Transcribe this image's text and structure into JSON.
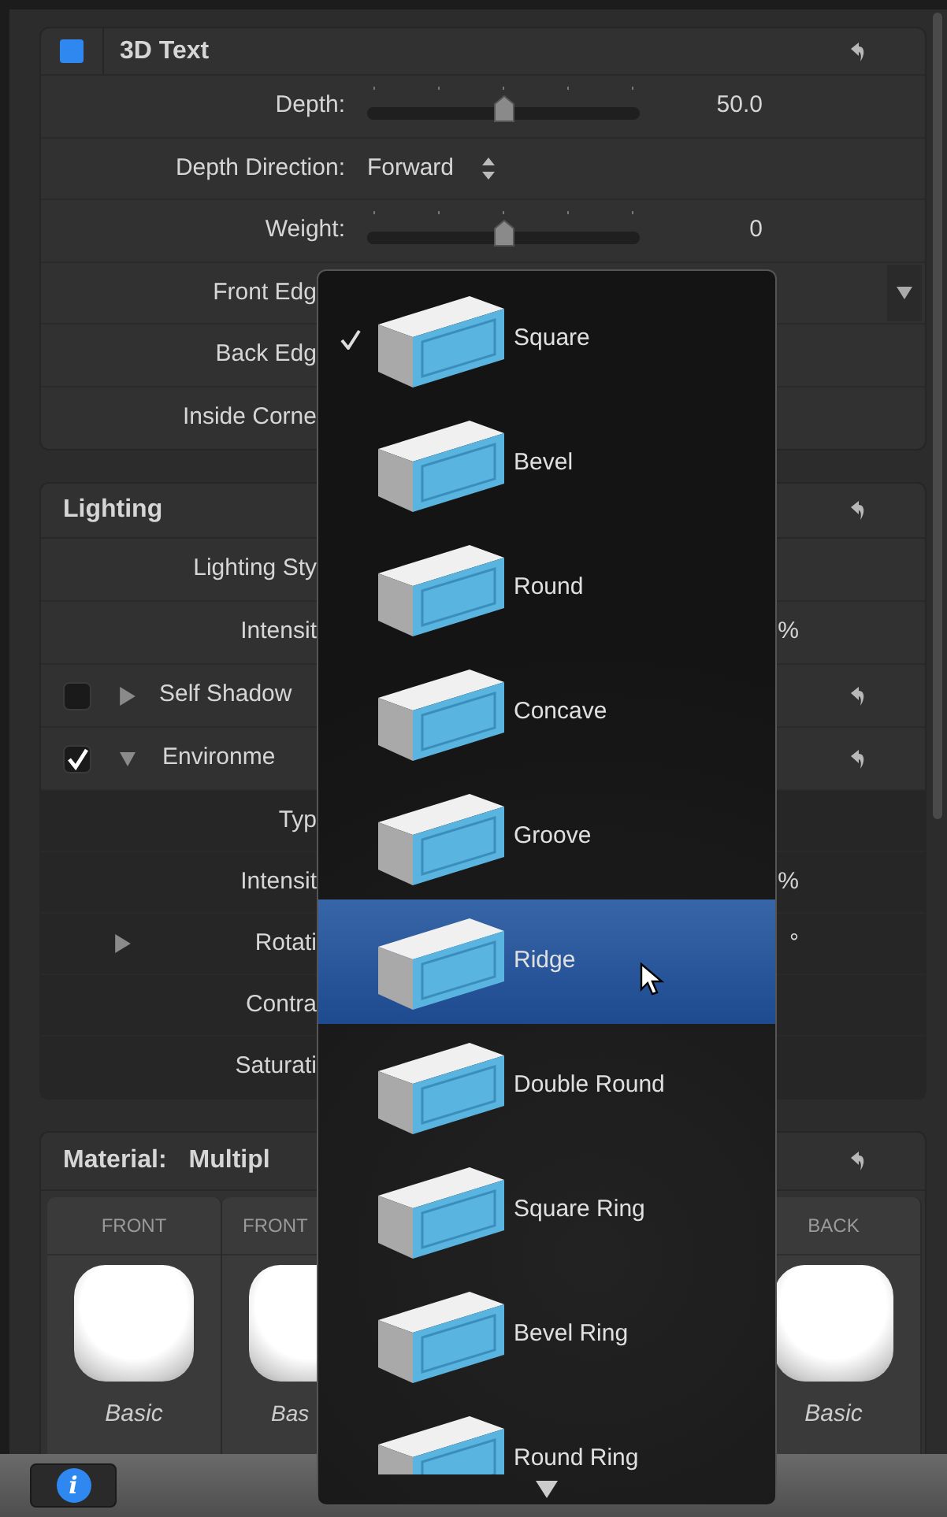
{
  "text3d_panel": {
    "title": "3D Text",
    "enabled": true,
    "rows": [
      {
        "kind": "slider",
        "label": "Depth:",
        "level": 0.5,
        "value": "50.0"
      },
      {
        "kind": "popup",
        "label": "Depth Direction:",
        "value": "Forward"
      },
      {
        "kind": "slider",
        "label": "Weight:",
        "level": 0.5,
        "value": "0"
      },
      {
        "kind": "dropdown",
        "label": "Front Edg"
      },
      {
        "kind": "plain",
        "label": "Back Edg"
      },
      {
        "kind": "plain",
        "label": "Inside Corne"
      }
    ]
  },
  "lighting_panel": {
    "title": "Lighting",
    "rows": [
      {
        "kind": "plain",
        "label": "Lighting Sty"
      },
      {
        "kind": "plain",
        "label": "Intensit",
        "value": "%"
      },
      {
        "kind": "group",
        "label": "Self Shadow",
        "checked": false,
        "expanded": false
      },
      {
        "kind": "group",
        "label": "Environme",
        "checked": true,
        "expanded": true
      }
    ],
    "environment_rows": [
      {
        "label": "Typ"
      },
      {
        "label": "Intensit",
        "value": "%"
      },
      {
        "label": "Rotati",
        "value": "°",
        "expanded": false
      },
      {
        "label": "Contra"
      },
      {
        "label": "Saturati"
      }
    ]
  },
  "material_panel": {
    "title": "Material:",
    "value": "Multipl",
    "cards": [
      {
        "title": "FRONT",
        "name": "Basic"
      },
      {
        "title": "FRONT",
        "name": "Bas"
      },
      {
        "title": "BACK",
        "name": "Basic"
      }
    ]
  },
  "edge_menu": {
    "items": [
      {
        "label": "Square",
        "checked": true,
        "highlighted": false
      },
      {
        "label": "Bevel",
        "checked": false,
        "highlighted": false
      },
      {
        "label": "Round",
        "checked": false,
        "highlighted": false
      },
      {
        "label": "Concave",
        "checked": false,
        "highlighted": false
      },
      {
        "label": "Groove",
        "checked": false,
        "highlighted": false
      },
      {
        "label": "Ridge",
        "checked": false,
        "highlighted": true
      },
      {
        "label": "Double Round",
        "checked": false,
        "highlighted": false
      },
      {
        "label": "Square Ring",
        "checked": false,
        "highlighted": false
      },
      {
        "label": "Bevel Ring",
        "checked": false,
        "highlighted": false
      },
      {
        "label": "Round Ring",
        "checked": false,
        "highlighted": false
      }
    ]
  },
  "bottom_bar": {
    "info_button": "i"
  }
}
